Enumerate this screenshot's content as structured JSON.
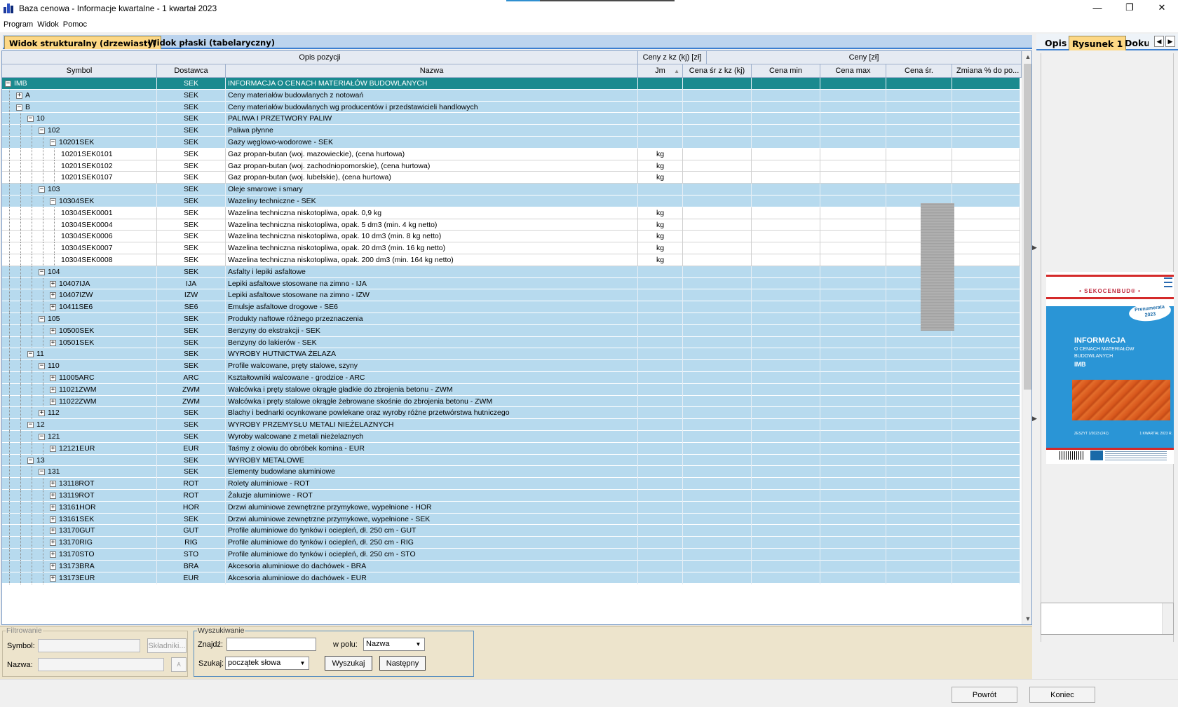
{
  "window": {
    "title": "Baza cenowa - Informacje kwartalne - 1 kwartał 2023",
    "controls": [
      "—",
      "❐",
      "✕"
    ]
  },
  "menu": [
    "Program",
    "Widok",
    "Pomoc"
  ],
  "tabs": [
    "Widok strukturalny (drzewiasty)",
    "Widok płaski (tabelaryczny)"
  ],
  "table": {
    "group_headers": {
      "opis": "Opis pozycji",
      "ceny_kz": "Ceny z kz (kj) [zł]",
      "ceny": "Ceny [zł]"
    },
    "columns": {
      "symbol": "Symbol",
      "dostawca": "Dostawca",
      "nazwa": "Nazwa",
      "jm": "Jm",
      "kz": "Cena śr z kz (kj)",
      "min": "Cena min",
      "max": "Cena max",
      "sr": "Cena śr.",
      "zmiana": "Zmiana % do po..."
    },
    "sort_indicator": "▲",
    "rows": [
      {
        "sym": "IMB",
        "dost": "SEK",
        "name": "INFORMACJA O CENACH MATERIAŁÓW BUDOWLANYCH",
        "jm": "",
        "lvl": 0,
        "exp": "⊟",
        "kind": "selected"
      },
      {
        "sym": "A",
        "dost": "SEK",
        "name": "Ceny materiałów budowlanych z notowań",
        "jm": "",
        "lvl": 1,
        "exp": "⊞",
        "kind": "folder"
      },
      {
        "sym": "B",
        "dost": "SEK",
        "name": "Ceny materiałów budowlanych wg producentów i przedstawicieli handlowych",
        "jm": "",
        "lvl": 1,
        "exp": "⊟",
        "kind": "folder"
      },
      {
        "sym": "10",
        "dost": "SEK",
        "name": "PALIWA I PRZETWORY PALIW",
        "jm": "",
        "lvl": 2,
        "exp": "⊟",
        "kind": "folder"
      },
      {
        "sym": "102",
        "dost": "SEK",
        "name": "Paliwa płynne",
        "jm": "",
        "lvl": 3,
        "exp": "⊟",
        "kind": "folder"
      },
      {
        "sym": "10201SEK",
        "dost": "SEK",
        "name": "Gazy węglowo-wodorowe - SEK",
        "jm": "",
        "lvl": 4,
        "exp": "⊟",
        "kind": "folder"
      },
      {
        "sym": "10201SEK0101",
        "dost": "SEK",
        "name": "Gaz propan-butan (woj. mazowieckie), (cena hurtowa)",
        "jm": "kg",
        "lvl": 5,
        "exp": "",
        "kind": "leaf"
      },
      {
        "sym": "10201SEK0102",
        "dost": "SEK",
        "name": "Gaz propan-butan (woj. zachodniopomorskie), (cena hurtowa)",
        "jm": "kg",
        "lvl": 5,
        "exp": "",
        "kind": "leaf"
      },
      {
        "sym": "10201SEK0107",
        "dost": "SEK",
        "name": "Gaz propan-butan (woj. lubelskie), (cena hurtowa)",
        "jm": "kg",
        "lvl": 5,
        "exp": "",
        "kind": "leaf"
      },
      {
        "sym": "103",
        "dost": "SEK",
        "name": "Oleje smarowe i smary",
        "jm": "",
        "lvl": 3,
        "exp": "⊟",
        "kind": "folder"
      },
      {
        "sym": "10304SEK",
        "dost": "SEK",
        "name": "Wazeliny techniczne - SEK",
        "jm": "",
        "lvl": 4,
        "exp": "⊟",
        "kind": "folder"
      },
      {
        "sym": "10304SEK0001",
        "dost": "SEK",
        "name": "Wazelina techniczna niskotopliwa, opak. 0,9 kg",
        "jm": "kg",
        "lvl": 5,
        "exp": "",
        "kind": "leaf"
      },
      {
        "sym": "10304SEK0004",
        "dost": "SEK",
        "name": "Wazelina techniczna niskotopliwa, opak. 5 dm3 (min. 4 kg netto)",
        "jm": "kg",
        "lvl": 5,
        "exp": "",
        "kind": "leaf"
      },
      {
        "sym": "10304SEK0006",
        "dost": "SEK",
        "name": "Wazelina techniczna niskotopliwa, opak. 10 dm3 (min. 8 kg netto)",
        "jm": "kg",
        "lvl": 5,
        "exp": "",
        "kind": "leaf"
      },
      {
        "sym": "10304SEK0007",
        "dost": "SEK",
        "name": "Wazelina techniczna niskotopliwa, opak. 20 dm3 (min. 16 kg netto)",
        "jm": "kg",
        "lvl": 5,
        "exp": "",
        "kind": "leaf"
      },
      {
        "sym": "10304SEK0008",
        "dost": "SEK",
        "name": "Wazelina techniczna niskotopliwa, opak. 200 dm3 (min. 164 kg netto)",
        "jm": "kg",
        "lvl": 5,
        "exp": "",
        "kind": "leaf"
      },
      {
        "sym": "104",
        "dost": "SEK",
        "name": "Asfalty i lepiki asfaltowe",
        "jm": "",
        "lvl": 3,
        "exp": "⊟",
        "kind": "folder"
      },
      {
        "sym": "10407IJA",
        "dost": "IJA",
        "name": "Lepiki asfaltowe stosowane na zimno - IJA",
        "jm": "",
        "lvl": 4,
        "exp": "⊞",
        "kind": "folder"
      },
      {
        "sym": "10407IZW",
        "dost": "IZW",
        "name": "Lepiki asfaltowe stosowane na zimno - IZW",
        "jm": "",
        "lvl": 4,
        "exp": "⊞",
        "kind": "folder"
      },
      {
        "sym": "10411SE6",
        "dost": "SE6",
        "name": "Emulsje asfaltowe drogowe - SE6",
        "jm": "",
        "lvl": 4,
        "exp": "⊞",
        "kind": "folder"
      },
      {
        "sym": "105",
        "dost": "SEK",
        "name": "Produkty naftowe różnego przeznaczenia",
        "jm": "",
        "lvl": 3,
        "exp": "⊟",
        "kind": "folder"
      },
      {
        "sym": "10500SEK",
        "dost": "SEK",
        "name": "Benzyny do ekstrakcji - SEK",
        "jm": "",
        "lvl": 4,
        "exp": "⊞",
        "kind": "folder"
      },
      {
        "sym": "10501SEK",
        "dost": "SEK",
        "name": "Benzyny do lakierów - SEK",
        "jm": "",
        "lvl": 4,
        "exp": "⊞",
        "kind": "folder"
      },
      {
        "sym": "11",
        "dost": "SEK",
        "name": "WYROBY HUTNICTWA ŻELAZA",
        "jm": "",
        "lvl": 2,
        "exp": "⊟",
        "kind": "folder"
      },
      {
        "sym": "110",
        "dost": "SEK",
        "name": "Profile walcowane, pręty stalowe, szyny",
        "jm": "",
        "lvl": 3,
        "exp": "⊟",
        "kind": "folder"
      },
      {
        "sym": "11005ARC",
        "dost": "ARC",
        "name": "Kształtowniki walcowane - grodzice - ARC",
        "jm": "",
        "lvl": 4,
        "exp": "⊞",
        "kind": "folder"
      },
      {
        "sym": "11021ZWM",
        "dost": "ZWM",
        "name": "Walcówka i pręty stalowe okrągłe gładkie do zbrojenia betonu - ZWM",
        "jm": "",
        "lvl": 4,
        "exp": "⊞",
        "kind": "folder"
      },
      {
        "sym": "11022ZWM",
        "dost": "ZWM",
        "name": "Walcówka i pręty stalowe okrągłe żebrowane skośnie do zbrojenia betonu - ZWM",
        "jm": "",
        "lvl": 4,
        "exp": "⊞",
        "kind": "folder"
      },
      {
        "sym": "112",
        "dost": "SEK",
        "name": "Blachy i bednarki ocynkowane powlekane oraz wyroby różne przetwórstwa hutniczego",
        "jm": "",
        "lvl": 3,
        "exp": "⊞",
        "kind": "folder"
      },
      {
        "sym": "12",
        "dost": "SEK",
        "name": "WYROBY PRZEMYSŁU METALI NIEŻELAZNYCH",
        "jm": "",
        "lvl": 2,
        "exp": "⊟",
        "kind": "folder"
      },
      {
        "sym": "121",
        "dost": "SEK",
        "name": "Wyroby walcowane z metali nieżelaznych",
        "jm": "",
        "lvl": 3,
        "exp": "⊟",
        "kind": "folder"
      },
      {
        "sym": "12121EUR",
        "dost": "EUR",
        "name": "Taśmy z ołowiu do obróbek komina - EUR",
        "jm": "",
        "lvl": 4,
        "exp": "⊞",
        "kind": "folder"
      },
      {
        "sym": "13",
        "dost": "SEK",
        "name": "WYROBY METALOWE",
        "jm": "",
        "lvl": 2,
        "exp": "⊟",
        "kind": "folder"
      },
      {
        "sym": "131",
        "dost": "SEK",
        "name": "Elementy budowlane aluminiowe",
        "jm": "",
        "lvl": 3,
        "exp": "⊟",
        "kind": "folder"
      },
      {
        "sym": "13118ROT",
        "dost": "ROT",
        "name": "Rolety aluminiowe - ROT",
        "jm": "",
        "lvl": 4,
        "exp": "⊞",
        "kind": "folder"
      },
      {
        "sym": "13119ROT",
        "dost": "ROT",
        "name": "Żaluzje aluminiowe - ROT",
        "jm": "",
        "lvl": 4,
        "exp": "⊞",
        "kind": "folder"
      },
      {
        "sym": "13161HOR",
        "dost": "HOR",
        "name": "Drzwi aluminiowe zewnętrzne przymykowe, wypełnione - HOR",
        "jm": "",
        "lvl": 4,
        "exp": "⊞",
        "kind": "folder"
      },
      {
        "sym": "13161SEK",
        "dost": "SEK",
        "name": "Drzwi aluminiowe zewnętrzne przymykowe, wypełnione - SEK",
        "jm": "",
        "lvl": 4,
        "exp": "⊞",
        "kind": "folder"
      },
      {
        "sym": "13170GUT",
        "dost": "GUT",
        "name": "Profile aluminiowe do tynków i ociepleń, dł. 250 cm - GUT",
        "jm": "",
        "lvl": 4,
        "exp": "⊞",
        "kind": "folder"
      },
      {
        "sym": "13170RIG",
        "dost": "RIG",
        "name": "Profile aluminiowe do tynków i ociepleń, dł. 250 cm - RIG",
        "jm": "",
        "lvl": 4,
        "exp": "⊞",
        "kind": "folder"
      },
      {
        "sym": "13170STO",
        "dost": "STO",
        "name": "Profile aluminiowe do tynków i ociepleń, dł. 250 cm - STO",
        "jm": "",
        "lvl": 4,
        "exp": "⊞",
        "kind": "folder"
      },
      {
        "sym": "13173BRA",
        "dost": "BRA",
        "name": "Akcesoria aluminiowe do dachówek - BRA",
        "jm": "",
        "lvl": 4,
        "exp": "⊞",
        "kind": "folder"
      },
      {
        "sym": "13173EUR",
        "dost": "EUR",
        "name": "Akcesoria aluminiowe do dachówek - EUR",
        "jm": "",
        "lvl": 4,
        "exp": "⊞",
        "kind": "folder"
      }
    ]
  },
  "filter": {
    "legend": "Filtrowanie",
    "symbol_label": "Symbol:",
    "nazwa_label": "Nazwa:",
    "skladniki_button": "Składniki...",
    "az_button": "A"
  },
  "search": {
    "legend": "Wyszukiwanie",
    "znajdz_label": "Znajdź:",
    "znajdz_value": "",
    "w_polu_label": "w polu:",
    "w_polu_value": "Nazwa",
    "szukaj_label": "Szukaj:",
    "szukaj_value": "początek słowa",
    "wyszukaj_button": "Wyszukaj",
    "nastepny_button": "Następny"
  },
  "right_panel": {
    "tabs": [
      "Opis",
      "Rysunek 1",
      "Doku"
    ],
    "cover": {
      "brand": "• SEKOCENBUD® •",
      "stamp": "Prenumerata 2023",
      "title": "INFORMACJA",
      "subtitle": "O CENACH MATERIAŁÓW BUDOWLANYCH",
      "code": "IMB",
      "issue": "ZESZYT 1/2023 (241)",
      "quarter": "1 KWARTAŁ 2023 R."
    }
  },
  "footer": {
    "back_button": "Powrót",
    "end_button": "Koniec"
  }
}
